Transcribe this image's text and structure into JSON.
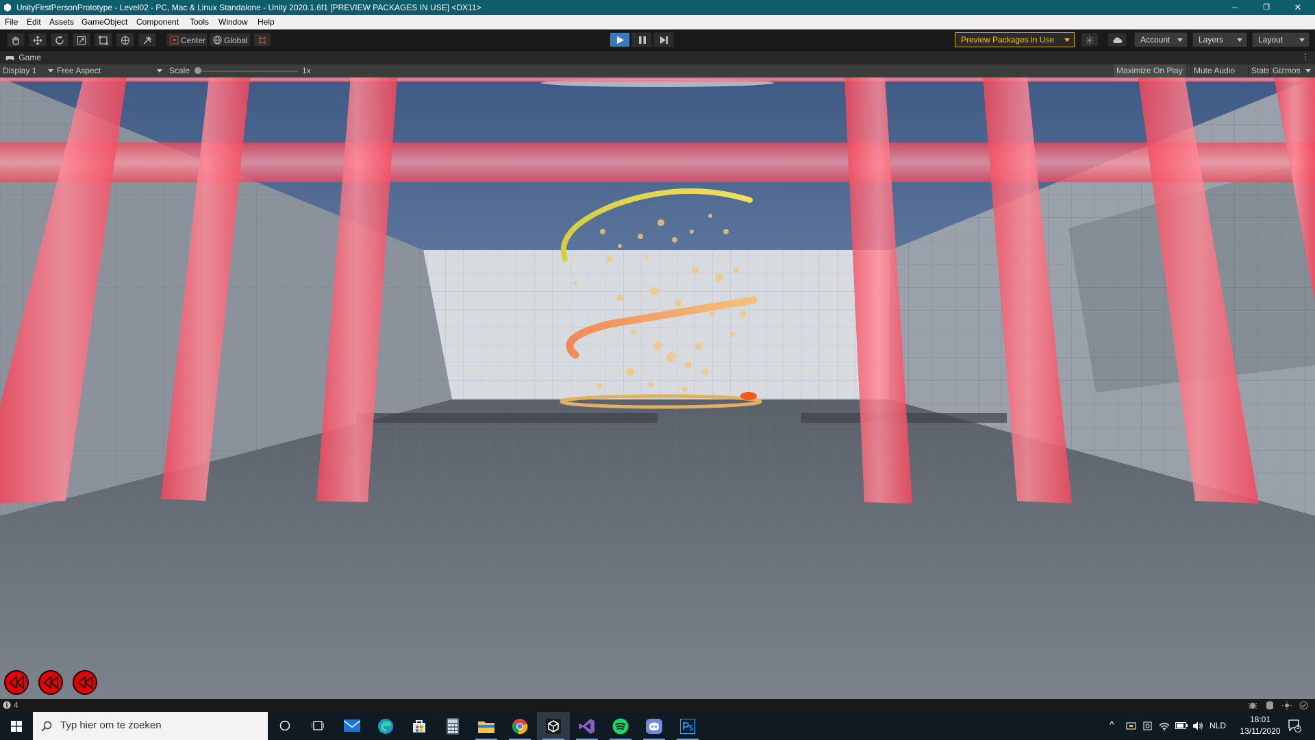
{
  "window": {
    "title": "UnityFirstPersonPrototype - Level02 - PC, Mac & Linux Standalone - Unity 2020.1.6f1 [PREVIEW PACKAGES IN USE] <DX11>",
    "controls": {
      "minimize": "–",
      "restore": "❐",
      "close": "✕"
    }
  },
  "menu": [
    "File",
    "Edit",
    "Assets",
    "GameObject",
    "Component",
    "Tools",
    "Window",
    "Help"
  ],
  "toolbar": {
    "tools": [
      "hand-icon",
      "move-icon",
      "rotate-icon",
      "scale-icon",
      "rect-icon",
      "transform-icon",
      "custom-tool-icon"
    ],
    "pivot_mode": "Center",
    "pivot_rotation": "Global",
    "preview_packages": "Preview Packages in Use",
    "account": "Account",
    "layers": "Layers",
    "layout": "Layout",
    "playing": true
  },
  "game_tab": {
    "label": "Game"
  },
  "game_toolbar": {
    "display": "Display 1",
    "aspect": "Free Aspect",
    "scale_label": "Scale",
    "scale_value": "1x",
    "maximize_on_play": "Maximize On Play",
    "mute_audio": "Mute Audio",
    "stats": "Stats",
    "gizmos": "Gizmos"
  },
  "hud": {
    "rewind_charges": 3,
    "rewind_color": "#e60000"
  },
  "statusbar": {
    "count": "4"
  },
  "taskbar": {
    "search_placeholder": "Typ hier om te zoeken",
    "apps": [
      "cortana-icon",
      "task-view-icon",
      "mail-icon",
      "edge-icon",
      "store-icon",
      "calculator-icon",
      "file-explorer-icon",
      "chrome-icon",
      "unity-icon",
      "visual-studio-icon",
      "spotify-icon",
      "discord-icon",
      "photoshop-icon"
    ],
    "language": "NLD",
    "time": "18:01",
    "date": "13/11/2020",
    "notifications": "1"
  }
}
